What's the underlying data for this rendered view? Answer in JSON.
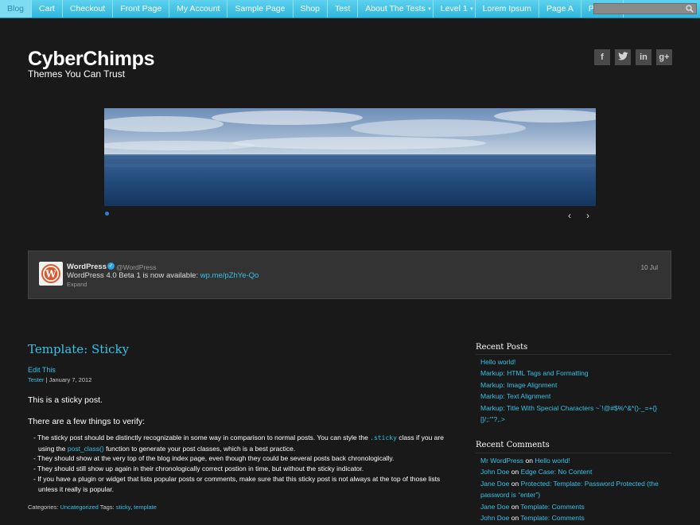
{
  "nav": {
    "items": [
      {
        "label": "Blog",
        "has_sub": false,
        "active": true
      },
      {
        "label": "Cart",
        "has_sub": false,
        "active": false
      },
      {
        "label": "Checkout",
        "has_sub": false,
        "active": false
      },
      {
        "label": "Front Page",
        "has_sub": false,
        "active": false
      },
      {
        "label": "My Account",
        "has_sub": false,
        "active": false
      },
      {
        "label": "Sample Page",
        "has_sub": false,
        "active": false
      },
      {
        "label": "Shop",
        "has_sub": false,
        "active": false
      },
      {
        "label": "Test",
        "has_sub": false,
        "active": false
      },
      {
        "label": "About The Tests",
        "has_sub": true,
        "active": false
      },
      {
        "label": "Level 1",
        "has_sub": true,
        "active": false
      },
      {
        "label": "Lorem Ipsum",
        "has_sub": false,
        "active": false
      },
      {
        "label": "Page A",
        "has_sub": false,
        "active": false
      },
      {
        "label": "Page B",
        "has_sub": false,
        "active": false
      }
    ],
    "search_placeholder": "",
    "caret_glyph": "▾"
  },
  "header": {
    "title": "CyberChimps",
    "tagline": "Themes You Can Trust",
    "social_icons": [
      "facebook-icon",
      "twitter-icon",
      "linkedin-icon",
      "google-plus-icon"
    ],
    "social_glyphs": [
      "f",
      "t",
      "in",
      "g+"
    ]
  },
  "slider": {
    "prev": "‹",
    "next": "›"
  },
  "tweet": {
    "name": "WordPress",
    "verified_glyph": "✓",
    "handle": "@WordPress",
    "text": "WordPress 4.0 Beta 1 is now available:",
    "link": "wp.me/pZhYe-Qo",
    "expand": "Expand",
    "date": "10 Jul"
  },
  "post": {
    "title": "Template: Sticky",
    "edit": "Edit This",
    "author": "Tester",
    "date_sep": " | ",
    "date": "January 7, 2012",
    "p1": "This is a sticky post.",
    "p2": "There are a few things to verify:",
    "bullets": {
      "b1_pre": "- The sticky post should be distinctly recognizable in some way in comparison to normal posts. You can style the ",
      "b1_code": ".sticky",
      "b1_mid": " class if you are using the ",
      "b1_link": "post_class()",
      "b1_post": " function to generate your post classes, which is a best practice.",
      "b2": "- They should show at the very top of the blog index page, even though they could be several posts back chronologically.",
      "b3": "- They should still show up again in their chronologically correct postion in time, but without the sticky indicator.",
      "b4": "- If you have a plugin or widget that lists popular posts or comments, make sure that this sticky post is not always at the top of those lists unless it really is popular."
    },
    "footer": {
      "categories_label": "Categories: ",
      "category": "Uncategorized",
      "tags_label": " Tags: ",
      "tag1": "sticky",
      "tag_sep": ", ",
      "tag2": "template"
    }
  },
  "sidebar": {
    "recent_posts_title": "Recent Posts",
    "recent_posts": [
      "Hello world!",
      "Markup: HTML Tags and Formatting",
      "Markup: Image Alignment",
      "Markup: Text Alignment",
      "Markup: Title With Special Characters ~`!@#$%^&*()-_=+{}[]/;:'\"?,.>"
    ],
    "recent_comments_title": "Recent Comments",
    "on_word": " on ",
    "recent_comments": [
      {
        "author": "Mr WordPress",
        "post": "Hello world!"
      },
      {
        "author": "John Doe",
        "post": "Edge Case: No Content"
      },
      {
        "author": "Jane Doe",
        "post": "Protected: Template: Password Protected (the password is “enter”)"
      },
      {
        "author": "Jane Doe",
        "post": "Template: Comments"
      },
      {
        "author": "John Doe",
        "post": "Template: Comments"
      }
    ]
  }
}
